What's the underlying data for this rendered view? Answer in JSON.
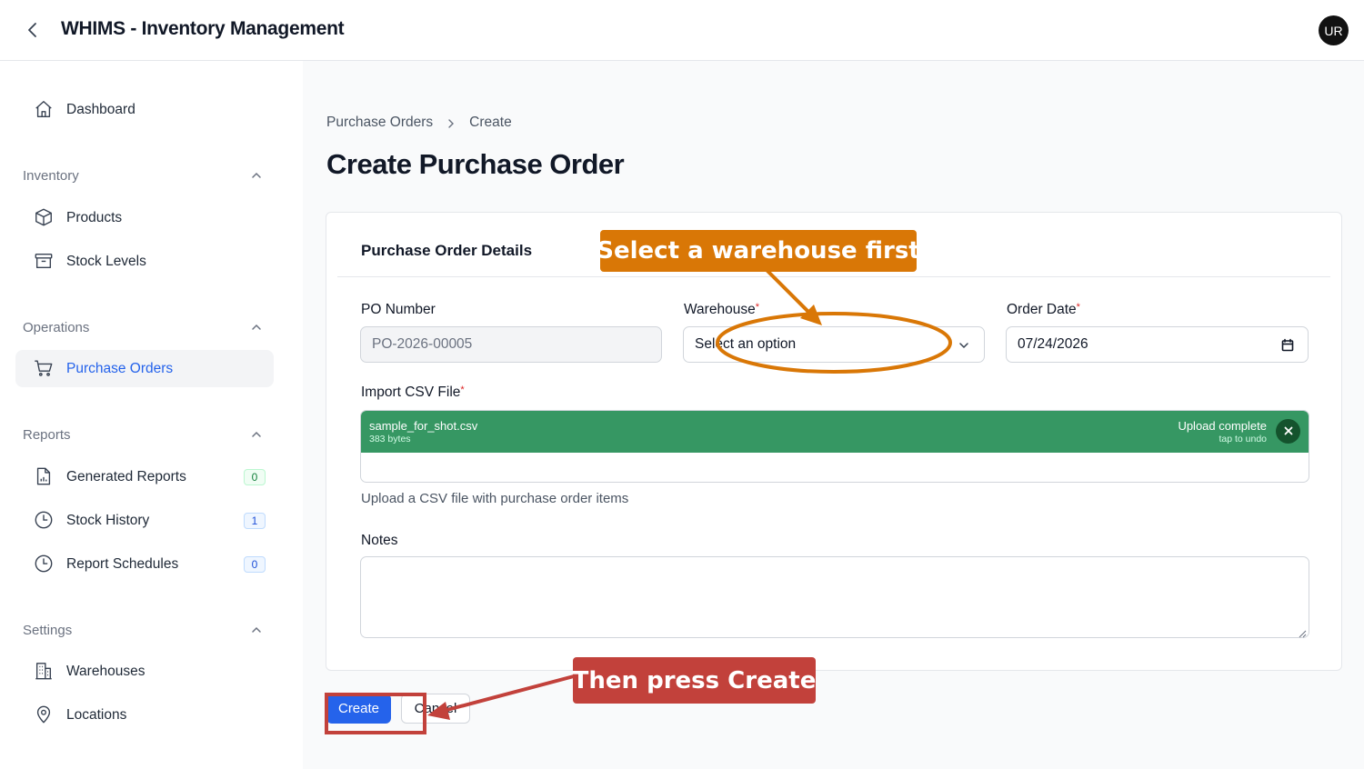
{
  "header": {
    "title": "WHIMS - Inventory Management",
    "avatar_initials": "UR"
  },
  "sidebar": {
    "dashboard": "Dashboard",
    "groups": {
      "inventory": "Inventory",
      "operations": "Operations",
      "reports": "Reports",
      "settings": "Settings"
    },
    "items": {
      "products": "Products",
      "stock_levels": "Stock Levels",
      "purchase_orders": "Purchase Orders",
      "generated_reports": {
        "label": "Generated Reports",
        "badge": "0"
      },
      "stock_history": {
        "label": "Stock History",
        "badge": "1"
      },
      "report_schedules": {
        "label": "Report Schedules",
        "badge": "0"
      },
      "warehouses": "Warehouses",
      "locations": "Locations"
    },
    "active_item": "purchase_orders"
  },
  "breadcrumb": [
    "Purchase Orders",
    "Create"
  ],
  "page_title": "Create Purchase Order",
  "form": {
    "section_heading": "Purchase Order Details",
    "po_number": {
      "label": "PO Number",
      "value": "PO-2026-00005"
    },
    "warehouse": {
      "label": "Warehouse",
      "required_mark": "*",
      "value": "Select an option"
    },
    "order_date": {
      "label": "Order Date",
      "required_mark": "*",
      "value": "07/24/2026"
    },
    "csv": {
      "label": "Import CSV File",
      "required_mark": "*",
      "file_name": "sample_for_shot.csv",
      "file_size": "383 bytes",
      "status": "Upload complete",
      "undo_hint": "tap to undo",
      "help": "Upload a CSV file with purchase order items"
    },
    "notes": {
      "label": "Notes",
      "value": ""
    }
  },
  "actions": {
    "create": "Create",
    "cancel": "Cancel"
  },
  "annotations": {
    "callout_warehouse": "Select a warehouse first",
    "callout_create": "Then press Create",
    "colors": {
      "orange": "#d97706",
      "red": "#c2413b"
    }
  },
  "colors": {
    "accent": "#2563eb",
    "upload_success": "#369763"
  }
}
